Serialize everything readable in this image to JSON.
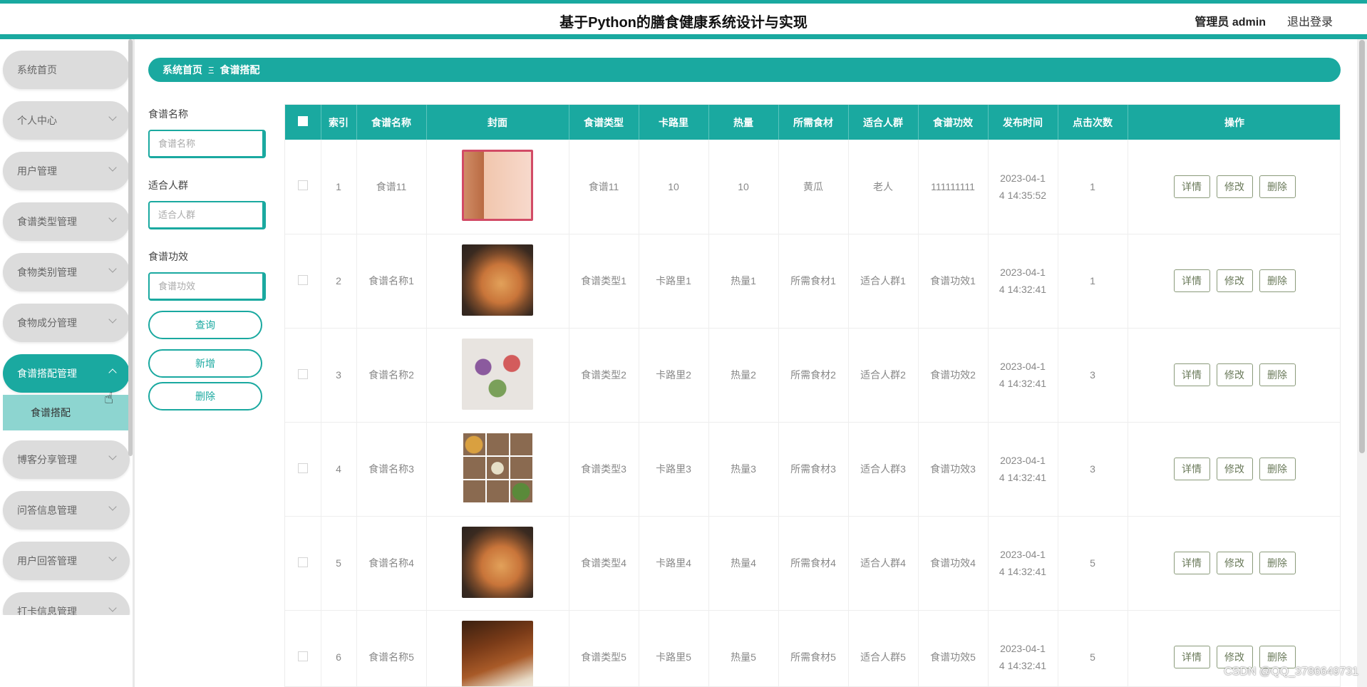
{
  "header": {
    "title": "基于Python的膳食健康系统设计与实现",
    "admin_label": "管理员 admin",
    "logout_label": "退出登录"
  },
  "sidebar": {
    "items": [
      {
        "label": "系统首页"
      },
      {
        "label": "个人中心"
      },
      {
        "label": "用户管理"
      },
      {
        "label": "食谱类型管理"
      },
      {
        "label": "食物类别管理"
      },
      {
        "label": "食物成分管理"
      },
      {
        "label": "食谱搭配管理"
      },
      {
        "label": "博客分享管理"
      },
      {
        "label": "问答信息管理"
      },
      {
        "label": "用户回答管理"
      },
      {
        "label": "打卡信息管理"
      }
    ],
    "submenu_label": "食谱搭配"
  },
  "breadcrumb": {
    "home": "系统首页",
    "separator": "Ξ",
    "current": "食谱搭配"
  },
  "filters": {
    "name_label": "食谱名称",
    "name_placeholder": "食谱名称",
    "crowd_label": "适合人群",
    "crowd_placeholder": "适合人群",
    "effect_label": "食谱功效",
    "effect_placeholder": "食谱功效",
    "search_button": "查询",
    "add_button": "新增",
    "delete_button": "删除"
  },
  "table": {
    "columns": [
      "索引",
      "食谱名称",
      "封面",
      "食谱类型",
      "卡路里",
      "热量",
      "所需食材",
      "适合人群",
      "食谱功效",
      "发布时间",
      "点击次数",
      "操作"
    ],
    "actions": {
      "detail": "详情",
      "edit": "修改",
      "delete": "删除"
    },
    "rows": [
      {
        "index": "1",
        "name": "食谱11",
        "type": "食谱11",
        "calorie": "10",
        "heat": "10",
        "ingredients": "黄瓜",
        "crowd": "老人",
        "effect": "111111111",
        "time1": "2023-04-1",
        "time2": "4 14:35:52",
        "clicks": "1"
      },
      {
        "index": "2",
        "name": "食谱名称1",
        "type": "食谱类型1",
        "calorie": "卡路里1",
        "heat": "热量1",
        "ingredients": "所需食材1",
        "crowd": "适合人群1",
        "effect": "食谱功效1",
        "time1": "2023-04-1",
        "time2": "4 14:32:41",
        "clicks": "1"
      },
      {
        "index": "3",
        "name": "食谱名称2",
        "type": "食谱类型2",
        "calorie": "卡路里2",
        "heat": "热量2",
        "ingredients": "所需食材2",
        "crowd": "适合人群2",
        "effect": "食谱功效2",
        "time1": "2023-04-1",
        "time2": "4 14:32:41",
        "clicks": "3"
      },
      {
        "index": "4",
        "name": "食谱名称3",
        "type": "食谱类型3",
        "calorie": "卡路里3",
        "heat": "热量3",
        "ingredients": "所需食材3",
        "crowd": "适合人群3",
        "effect": "食谱功效3",
        "time1": "2023-04-1",
        "time2": "4 14:32:41",
        "clicks": "3"
      },
      {
        "index": "5",
        "name": "食谱名称4",
        "type": "食谱类型4",
        "calorie": "卡路里4",
        "heat": "热量4",
        "ingredients": "所需食材4",
        "crowd": "适合人群4",
        "effect": "食谱功效4",
        "time1": "2023-04-1",
        "time2": "4 14:32:41",
        "clicks": "5"
      },
      {
        "index": "6",
        "name": "食谱名称5",
        "type": "食谱类型5",
        "calorie": "卡路里5",
        "heat": "热量5",
        "ingredients": "所需食材5",
        "crowd": "适合人群5",
        "effect": "食谱功效5",
        "time1": "2023-04-1",
        "time2": "4 14:32:41",
        "clicks": "5"
      }
    ]
  },
  "watermark": "CSDN @QQ_3786649731",
  "colors": {
    "accent": "#1aa9a0",
    "submenu": "#8dd5d0",
    "menu_bg": "#dcdcdc"
  }
}
